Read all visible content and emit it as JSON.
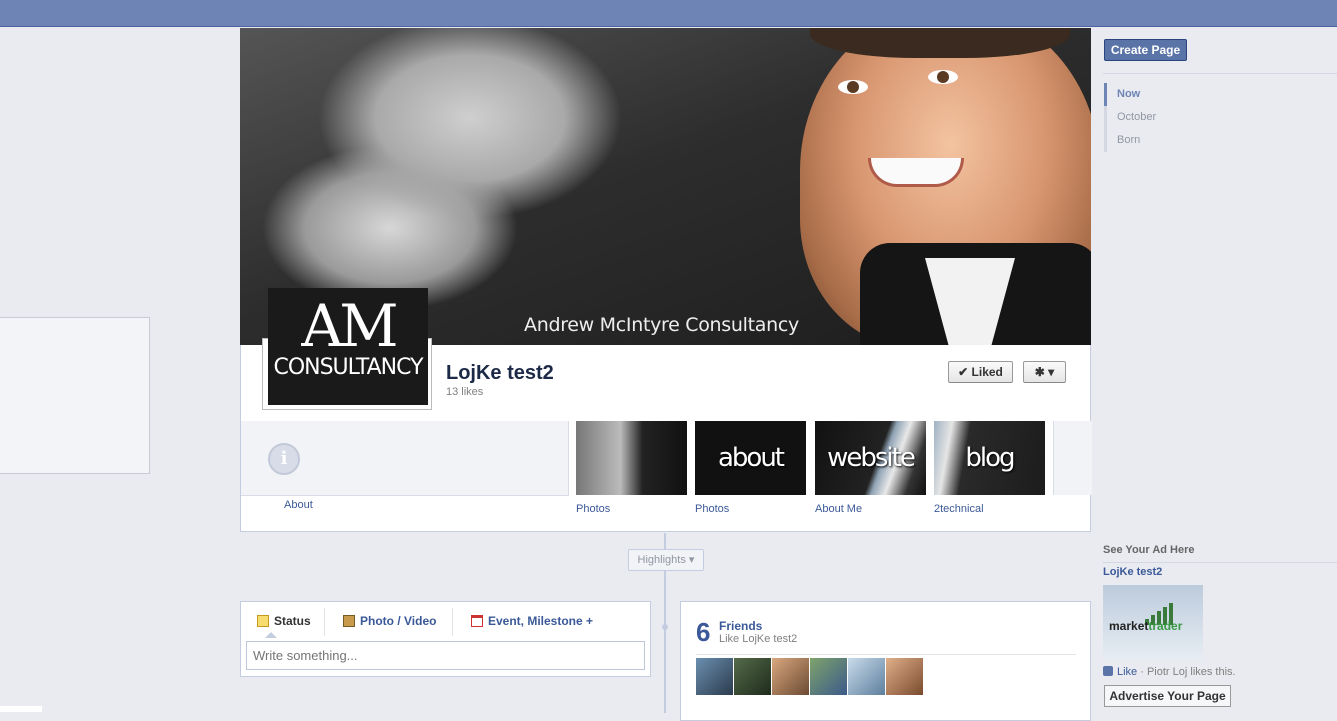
{
  "cover": {
    "caption": "Andrew McIntyre Consultancy"
  },
  "logo": {
    "line1": "AM",
    "line2": "CONSULTANCY"
  },
  "page": {
    "name": "LojKe test2",
    "likes": "13 likes"
  },
  "actions": {
    "liked_label": "Liked",
    "liked_icon": "✔",
    "gear_icon": "✱ ▾"
  },
  "apps": {
    "about_label": "About",
    "about_icon": "i",
    "tiles": [
      {
        "word": "",
        "label": "Photos"
      },
      {
        "word": "about",
        "label": "Photos"
      },
      {
        "word": "website",
        "label": "About Me"
      },
      {
        "word": "blog",
        "label": "2technical"
      }
    ]
  },
  "highlights": {
    "label": "Highlights ▾"
  },
  "composer": {
    "tabs": [
      "Status",
      "Photo / Video",
      "Event, Milestone +"
    ],
    "placeholder": "Write something..."
  },
  "friends": {
    "count": "6",
    "title": "Friends",
    "subtitle": "Like LojKe test2"
  },
  "sidebar": {
    "create_page": "Create Page",
    "timeline": [
      "Now",
      "October",
      "Born"
    ]
  },
  "ad": {
    "heading": "See Your Ad Here",
    "title": "LojKe test2",
    "image_text_a": "market",
    "image_text_b": "trader",
    "like_label": "Like",
    "like_rest": " · Piotr Loj likes this.",
    "advertise_button": "Advertise Your Page"
  },
  "colors": {
    "topbar": "#6d84b4",
    "link": "#3b5998",
    "background": "#e9ebf1"
  }
}
